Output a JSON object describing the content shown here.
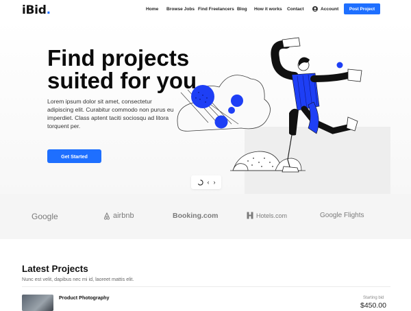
{
  "header": {
    "logo_text": "iBid",
    "logo_dot": ".",
    "nav": [
      "Home",
      "Browse Jobs",
      "Find Freelancers",
      "Blog",
      "How it works",
      "Contact"
    ],
    "account_label": "Account",
    "post_button": "Post Project"
  },
  "hero": {
    "title_line1": "Find projects",
    "title_line2": "suited for you",
    "body": "Lorem ipsum dolor sit amet, consectetur adipiscing elit. Curabitur commodo non purus eu imperdiet. Class aptent taciti sociosqu ad litora torquent per.",
    "cta": "Get Started",
    "slider_prev": "‹",
    "slider_next": "›"
  },
  "brands": [
    "Google",
    "airbnb",
    "Booking.com",
    "Hotels.com",
    "Google Flights"
  ],
  "latest": {
    "title": "Latest Projects",
    "subtitle": "Nunc est velit, dapibus nec mi id, laoreet mattis elit.",
    "project_name": "Product Photography",
    "price_label": "Starting bid",
    "price": "$450.00"
  },
  "colors": {
    "accent": "#1e6fff",
    "illustration_blue": "#1e3ff5"
  },
  "icons": {
    "account": "user-circle-icon",
    "spinner": "loading-icon",
    "prev": "chevron-left-icon",
    "next": "chevron-right-icon"
  }
}
